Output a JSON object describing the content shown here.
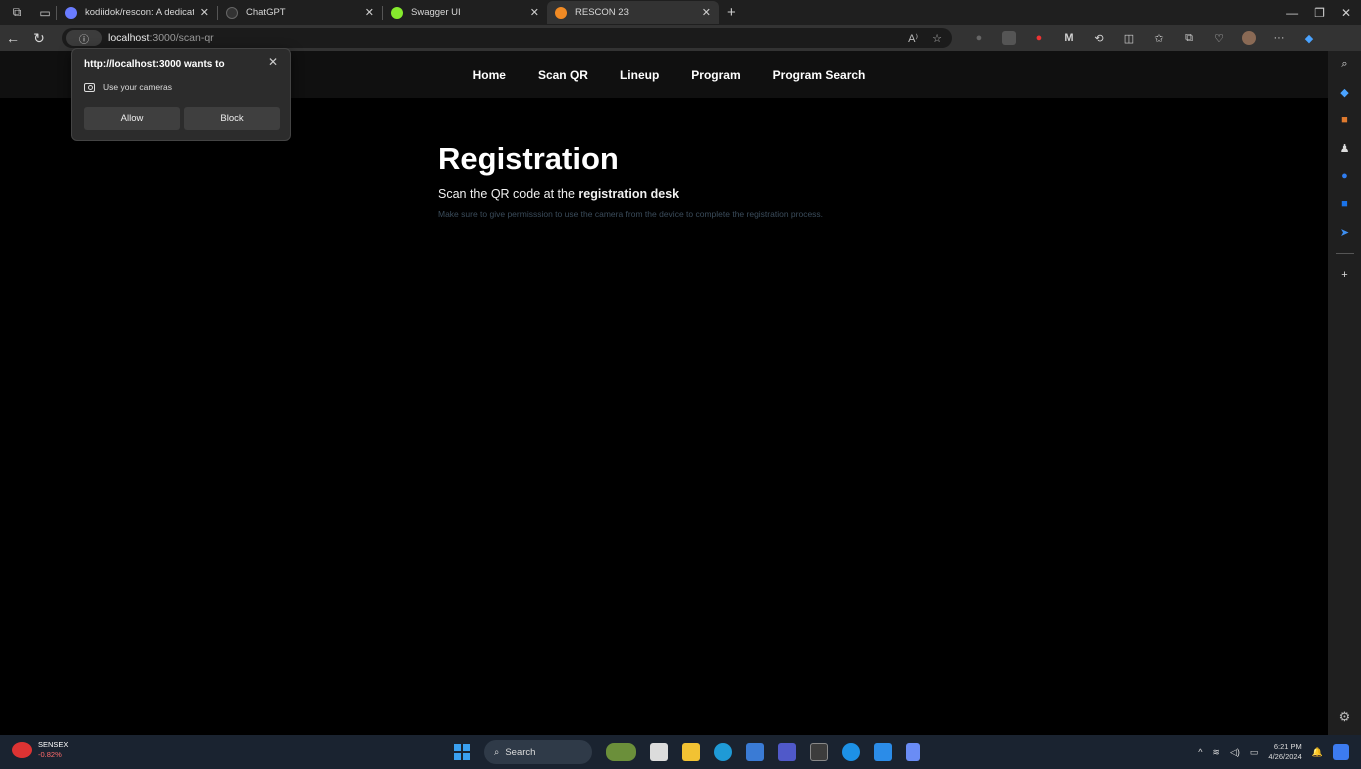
{
  "browser": {
    "tabs": [
      {
        "title": "kodiidok/rescon: A dedicated pla",
        "icon": "github-icon",
        "active": false
      },
      {
        "title": "ChatGPT",
        "icon": "chatgpt-icon",
        "active": false
      },
      {
        "title": "Swagger UI",
        "icon": "swagger-icon",
        "active": false
      },
      {
        "title": "RESCON 23",
        "icon": "rescon-icon",
        "active": true
      }
    ],
    "url_host": "localhost",
    "url_path": ":3000/scan-qr"
  },
  "permission_popup": {
    "title": "http://localhost:3000 wants to",
    "request": "Use your cameras",
    "allow_label": "Allow",
    "block_label": "Block"
  },
  "site_nav": {
    "items": [
      "Home",
      "Scan QR",
      "Lineup",
      "Program",
      "Program Search"
    ]
  },
  "hero": {
    "title": "Registration",
    "lead_prefix": "Scan the QR code at the ",
    "lead_bold": "registration desk",
    "note": "Make sure to give permisssion to use the camera from the device to complete the registration process."
  },
  "taskbar": {
    "widget_name": "SENSEX",
    "widget_value": "-0.82%",
    "search_label": "Search",
    "time": "6:21 PM",
    "date": "4/26/2024"
  },
  "colors": {
    "accent_blue": "#3aa0f0",
    "page_bg": "#000000",
    "nav_bg": "#101010"
  }
}
